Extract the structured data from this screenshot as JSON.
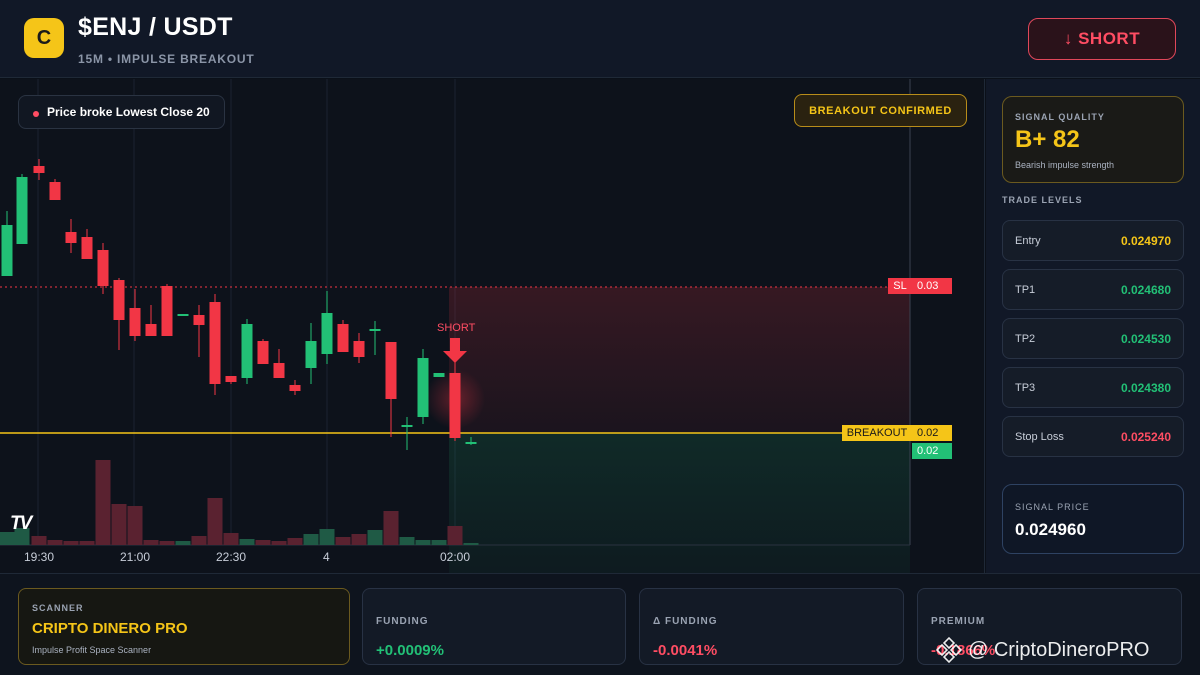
{
  "header": {
    "logo_letter": "C",
    "pair": "$ENJ / USDT",
    "subtitle": "15M • IMPULSE BREAKOUT",
    "short_button": "↓ SHORT"
  },
  "chart": {
    "broke_label": "Price broke Lowest Close 20",
    "confirm_label": "BREAKOUT CONFIRMED",
    "sl_tag": "SL",
    "sl_value": "0.03",
    "breakout_tag": "BREAKOUT",
    "breakout_value": "0.02",
    "current_value": "0.02",
    "short_marker": "SHORT",
    "time_labels": [
      "19:30",
      "21:00",
      "22:30",
      "4",
      "02:00"
    ],
    "tv_logo": "TV",
    "colors": {
      "up": "#22c076",
      "down": "#f23645",
      "breakout": "#f5c518"
    }
  },
  "signal_quality": {
    "label": "SIGNAL QUALITY",
    "value": "B+ 82",
    "description": "Bearish impulse strength"
  },
  "trade_levels": {
    "title": "TRADE LEVELS",
    "items": [
      {
        "name": "Entry",
        "value": "0.024970",
        "color": "#f5c518"
      },
      {
        "name": "TP1",
        "value": "0.024680",
        "color": "#22c076"
      },
      {
        "name": "TP2",
        "value": "0.024530",
        "color": "#22c076"
      },
      {
        "name": "TP3",
        "value": "0.024380",
        "color": "#22c076"
      },
      {
        "name": "Stop Loss",
        "value": "0.025240",
        "color": "#ff4d63"
      }
    ]
  },
  "signal_price": {
    "label": "SIGNAL PRICE",
    "value": "0.024960"
  },
  "bottom": {
    "scanner": {
      "label": "SCANNER",
      "name": "CRIPTO DINERO PRO",
      "description": "Impulse Profit Space Scanner"
    },
    "funding": {
      "label": "FUNDING",
      "value": "+0.0009%",
      "color": "#22c076"
    },
    "delta_funding": {
      "label": "Δ FUNDING",
      "value": "-0.0041%",
      "color": "#ff4d63"
    },
    "premium": {
      "label": "PREMIUM",
      "value": "-0.1866%",
      "color": "#ff4d63"
    },
    "watermark": "@ CriptoDineroPRO"
  }
}
